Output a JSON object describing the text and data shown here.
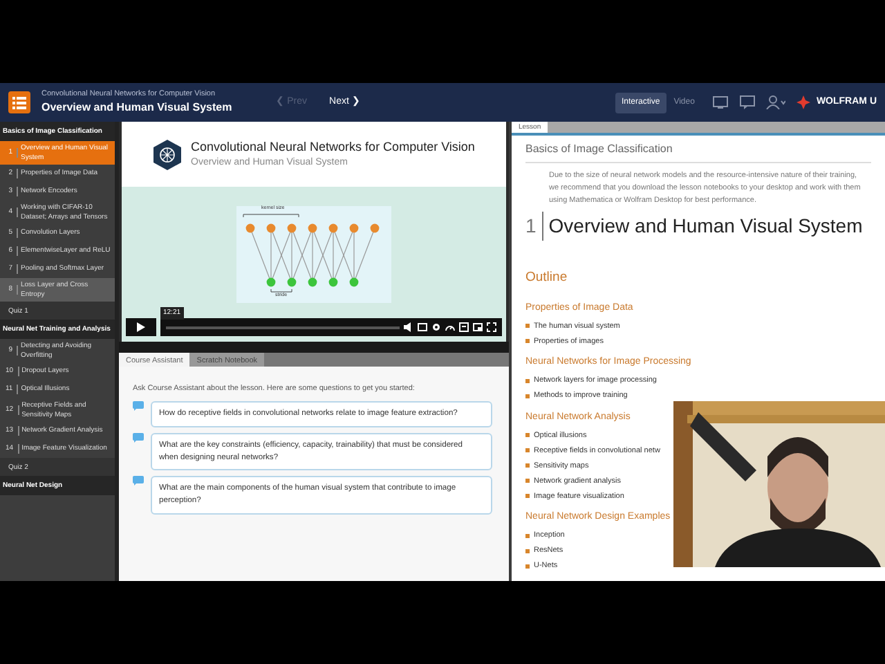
{
  "header": {
    "course_title": "Convolutional Neural Networks for Computer Vision",
    "lesson_title": "Overview and Human Visual System",
    "nav": [
      {
        "label": "Prev",
        "arrow": "❮",
        "disabled": true
      },
      {
        "label": "Next",
        "arrow": "❯",
        "disabled": false
      }
    ],
    "modes": [
      {
        "label": "Interactive",
        "selected": true
      },
      {
        "label": "Video",
        "selected": false
      }
    ],
    "brand": "WOLFRAM U"
  },
  "sidebar": [
    {
      "kind": "section",
      "label": "Basics of Image Classification"
    },
    {
      "kind": "lesson",
      "number": "1",
      "label": "Overview and Human Visual System",
      "selected": true,
      "hovered": false
    },
    {
      "kind": "lesson",
      "number": "2",
      "label": "Properties of Image Data",
      "selected": false,
      "hovered": false
    },
    {
      "kind": "lesson",
      "number": "3",
      "label": "Network Encoders",
      "selected": false,
      "hovered": false
    },
    {
      "kind": "lesson",
      "number": "4",
      "label": "Working with CIFAR-10 Dataset; Arrays and Tensors",
      "selected": false,
      "hovered": false
    },
    {
      "kind": "lesson",
      "number": "5",
      "label": "Convolution Layers",
      "selected": false,
      "hovered": false
    },
    {
      "kind": "lesson",
      "number": "6",
      "label": "ElementwiseLayer and ReLU",
      "selected": false,
      "hovered": false
    },
    {
      "kind": "lesson",
      "number": "7",
      "label": "Pooling and Softmax Layer",
      "selected": false,
      "hovered": false
    },
    {
      "kind": "lesson",
      "number": "8",
      "label": "Loss Layer and Cross Entropy",
      "selected": false,
      "hovered": true
    },
    {
      "kind": "quiz",
      "label": "Quiz 1"
    },
    {
      "kind": "section",
      "label": "Neural Net Training and Analysis"
    },
    {
      "kind": "lesson",
      "number": "9",
      "label": "Detecting and Avoiding Overfitting",
      "selected": false,
      "hovered": false
    },
    {
      "kind": "lesson",
      "number": "10",
      "label": "Dropout Layers",
      "selected": false,
      "hovered": false
    },
    {
      "kind": "lesson",
      "number": "11",
      "label": "Optical Illusions",
      "selected": false,
      "hovered": false
    },
    {
      "kind": "lesson",
      "number": "12",
      "label": "Receptive Fields and Sensitivity Maps",
      "selected": false,
      "hovered": false
    },
    {
      "kind": "lesson",
      "number": "13",
      "label": "Network Gradient Analysis",
      "selected": false,
      "hovered": false
    },
    {
      "kind": "lesson",
      "number": "14",
      "label": "Image Feature Visualization",
      "selected": false,
      "hovered": false
    },
    {
      "kind": "quiz",
      "label": "Quiz 2"
    },
    {
      "kind": "section",
      "label": "Neural Net Design"
    }
  ],
  "video": {
    "title": "Convolutional Neural Networks for Computer Vision",
    "subtitle": "Overview and Human Visual System",
    "diagram_top_label": "kernel size",
    "diagram_bottom_label": "stride",
    "time": "12:21"
  },
  "assistant": {
    "tabs": [
      {
        "label": "Course Assistant",
        "selected": true
      },
      {
        "label": "Scratch Notebook",
        "selected": false
      }
    ],
    "intro": "Ask Course Assistant about the lesson. Here are some questions to get you started:",
    "questions": [
      "How do receptive fields in convolutional networks relate to image feature extraction?",
      "What are the key constraints (efficiency, capacity, trainability) that must be considered when designing neural networks?",
      "What are the main components of the human visual system that contribute to image perception?"
    ]
  },
  "lesson": {
    "tab": "Lesson",
    "breadcrumb": "Basics of Image Classification",
    "notice": "Due to the size of neural network models and the resource-intensive nature of their training, we recommend that you download the lesson notebooks to your desktop and work with them using Mathematica or Wolfram Desktop for best performance.",
    "number": "1",
    "title": "Overview and Human Visual System",
    "outline_heading": "Outline",
    "groups": [
      {
        "heading": "Properties of Image Data",
        "items": [
          "The human visual system",
          "Properties of images"
        ]
      },
      {
        "heading": "Neural Networks for Image Processing",
        "items": [
          "Network layers for image processing",
          "Methods to improve training"
        ]
      },
      {
        "heading": "Neural Network Analysis",
        "items": [
          "Optical illusions",
          "Receptive fields in convolutional netw",
          "Sensitivity maps",
          "Network gradient analysis",
          "Image feature visualization"
        ]
      },
      {
        "heading": "Neural Network Design Examples",
        "items": [
          "Inception",
          "ResNets",
          "U-Nets"
        ]
      }
    ]
  }
}
